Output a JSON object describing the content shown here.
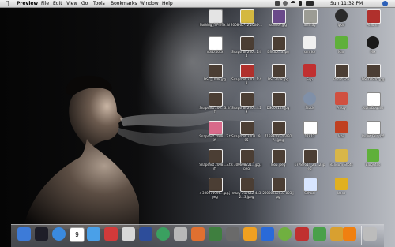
{
  "menubar": {
    "app_name": "Preview",
    "items": [
      "File",
      "Edit",
      "View",
      "Go",
      "Tools",
      "Bookmarks",
      "Window",
      "Help"
    ],
    "clock": "Sun 11:32 PM"
  },
  "desktop": {
    "icons": [
      {
        "label": "Nothing_fl Prefix.ipl",
        "kind": "doc-gray"
      },
      {
        "label": "2008-02-12 2004-...",
        "kind": "photo-yellow"
      },
      {
        "label": "sunrise.jpg",
        "kind": "photo-purple"
      },
      {
        "label": "Sunflag",
        "kind": "photo-gray"
      },
      {
        "label": "Ipod",
        "kind": "ipod"
      },
      {
        "label": "Albums",
        "kind": "photo-red"
      },
      {
        "label": "nudo.docx",
        "kind": "doc"
      },
      {
        "label": "Snapshot 200...1:44",
        "kind": "photo-dark"
      },
      {
        "label": "DSC00...3.jpg",
        "kind": "photo-dark"
      },
      {
        "label": "sunrise",
        "kind": "folder-white"
      },
      {
        "label": "Mac",
        "kind": "green-bug"
      },
      {
        "label": "Mix",
        "kind": "vinyl"
      },
      {
        "label": "DSC_1009.jpg",
        "kind": "photo-dark"
      },
      {
        "label": "Snapshot 200...1:48",
        "kind": "photo-red"
      },
      {
        "label": "DSC3008.jpg",
        "kind": "photo-dark"
      },
      {
        "label": "Sup",
        "kind": "house"
      },
      {
        "label": "Photo Eco",
        "kind": "photo-dark"
      },
      {
        "label": "DSC00826.jpg",
        "kind": "photo-dark"
      },
      {
        "label": "Snapshot 200...3.tiff",
        "kind": "photo-dark"
      },
      {
        "label": "Snapshot 200...4:29",
        "kind": "photo-dark"
      },
      {
        "label": "DSC00103.jpg",
        "kind": "photo-dark"
      },
      {
        "label": "Stock",
        "kind": "globe"
      },
      {
        "label": "Pretty",
        "kind": "figure"
      },
      {
        "label": "AlphaDog.avi",
        "kind": "doc"
      },
      {
        "label": "Snapshot 2008...3.tiff",
        "kind": "photo-pink"
      },
      {
        "label": "Snapshot 2008...9:05",
        "kind": "photo-dark"
      },
      {
        "label": "71583000-450927...jpeg",
        "kind": "photo-dark"
      },
      {
        "label": "17813",
        "kind": "doc"
      },
      {
        "label": "Mail",
        "kind": "brush"
      },
      {
        "label": "Bullet Fairy.rtf",
        "kind": "doc"
      },
      {
        "label": "Snapshot 2008...3.tiff",
        "kind": "photo-dark"
      },
      {
        "label": "s 300608221...jpg.jpeg",
        "kind": "photo-dark"
      },
      {
        "label": "mo5.jpeg",
        "kind": "photo-dark"
      },
      {
        "label": "17782614_24...2.jpeg",
        "kind": "photo-dark"
      },
      {
        "label": "Random Shots",
        "kind": "folder-yellow"
      },
      {
        "label": "Blogsites",
        "kind": "green-bug"
      },
      {
        "label": "s 300078996...jpg.jpeg",
        "kind": "photo-dark"
      },
      {
        "label": "many 217562 4432...3.jpeg",
        "kind": "photo-dark"
      },
      {
        "label": "20080602033 003.jpg",
        "kind": "photo-dark"
      },
      {
        "label": "School",
        "kind": "doc-blue"
      },
      {
        "label": "Icons",
        "kind": "bee"
      }
    ]
  },
  "dock": {
    "apps": [
      "Finder",
      "Dashboard",
      "Safari",
      "iCal",
      "iTunes",
      "Photo Booth",
      "Preview",
      "Spaces",
      "Time Machine",
      "System Preferences",
      "VLC Chat",
      "Adium",
      "Dictionary",
      "Garage",
      "Audio Hijack",
      "Torrent",
      "Transmission",
      "uTorrent",
      "Cyberduck",
      "VLC",
      "Trash"
    ],
    "calendar_day": "9"
  },
  "colors": {
    "menubar": "#e6e6e6",
    "desktop_dark": "#050505",
    "desktop_light": "#b9bcc2"
  }
}
